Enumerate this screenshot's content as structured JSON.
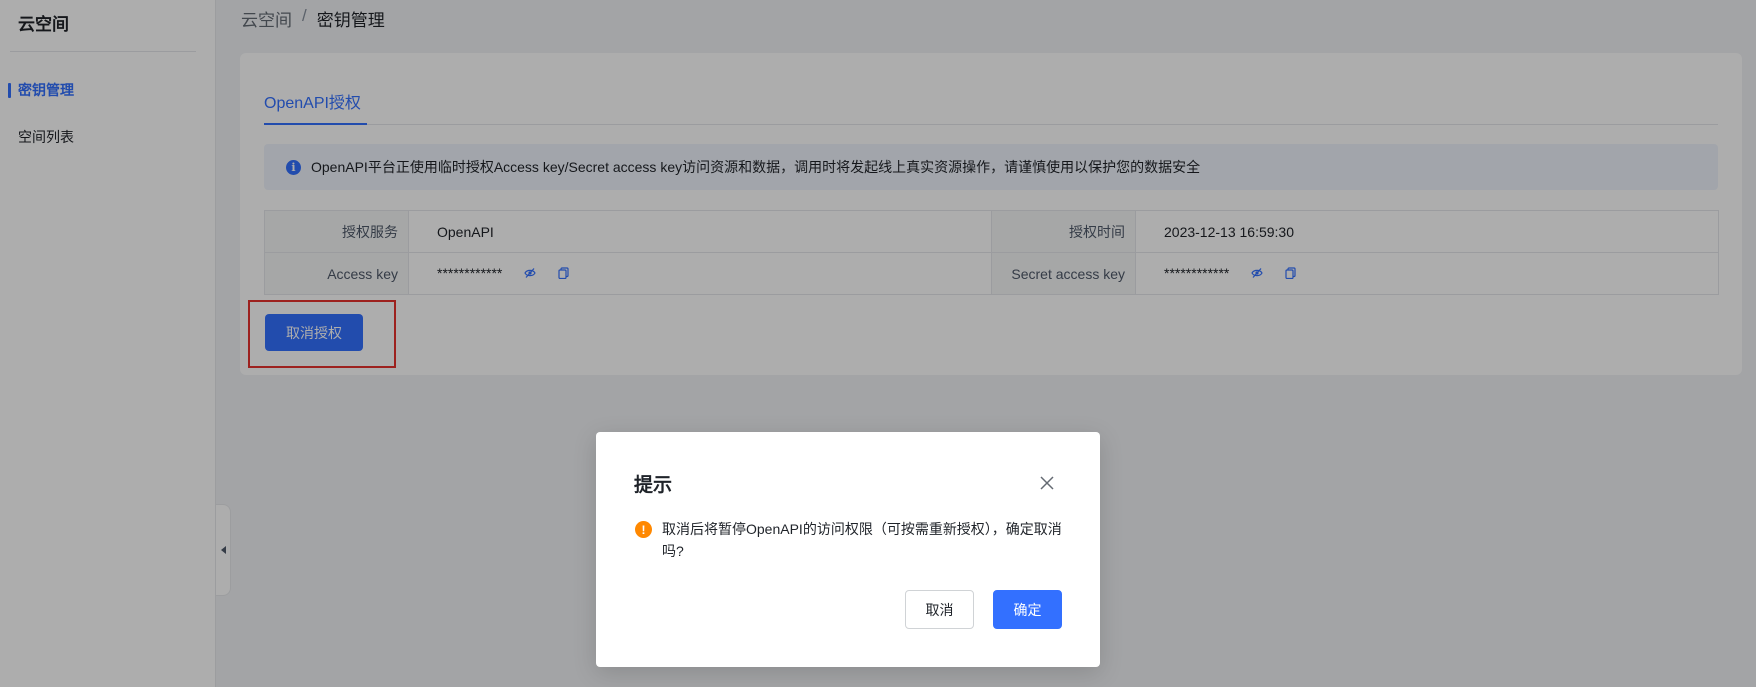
{
  "sidebar": {
    "brand": "云空间",
    "items": [
      {
        "label": "密钥管理",
        "active": true
      },
      {
        "label": "空间列表",
        "active": false
      }
    ],
    "collapse_icon": "chevron-left-icon"
  },
  "breadcrumb": {
    "root": "云空间",
    "separator": "/",
    "current": "密钥管理"
  },
  "tabs": [
    {
      "label": "OpenAPI授权",
      "active": true
    }
  ],
  "alert": {
    "icon": "info-icon",
    "text": "OpenAPI平台正使用临时授权Access key/Secret access key访问资源和数据，调用时将发起线上真实资源操作，请谨慎使用以保护您的数据安全"
  },
  "details": {
    "service_label": "授权服务",
    "service_value": "OpenAPI",
    "time_label": "授权时间",
    "time_value": "2023-12-13 16:59:30",
    "access_key_label": "Access key",
    "access_key_value": "************",
    "secret_key_label": "Secret access key",
    "secret_key_value": "************"
  },
  "revoke_button": "取消授权",
  "dialog": {
    "title": "提示",
    "icon": "warning-icon",
    "message": "取消后将暂停OpenAPI的访问权限（可按需重新授权），确定取消吗?",
    "cancel_label": "取消",
    "confirm_label": "确定"
  },
  "colors": {
    "primary": "#3370ff",
    "warning": "#ff8800",
    "highlight": "#e8322d"
  }
}
